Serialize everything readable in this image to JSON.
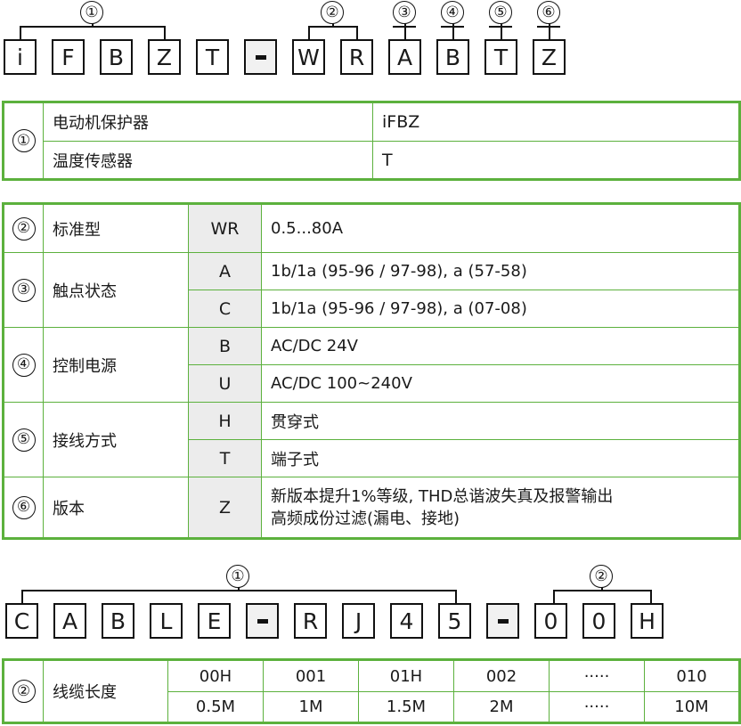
{
  "code1": {
    "chars": [
      "i",
      "F",
      "B",
      "Z",
      "T",
      "-",
      "W",
      "R",
      "A",
      "B",
      "T",
      "Z"
    ],
    "labels": [
      "①",
      "②",
      "③",
      "④",
      "⑤",
      "⑥"
    ]
  },
  "table1": {
    "group": "①",
    "rows": [
      {
        "desc": "电动机保护器",
        "value": "iFBZ"
      },
      {
        "desc": "温度传感器",
        "value": "T"
      }
    ]
  },
  "table2": {
    "groups": [
      {
        "num": "②",
        "name": "标准型",
        "rows": [
          {
            "code": "WR",
            "desc": "0.5...80A"
          }
        ]
      },
      {
        "num": "③",
        "name": "触点状态",
        "rows": [
          {
            "code": "A",
            "desc": "1b/1a (95-96 / 97-98), a (57-58)"
          },
          {
            "code": "C",
            "desc": "1b/1a (95-96 / 97-98), a (07-08)"
          }
        ]
      },
      {
        "num": "④",
        "name": "控制电源",
        "rows": [
          {
            "code": "B",
            "desc": "AC/DC 24V"
          },
          {
            "code": "U",
            "desc": "AC/DC 100~240V"
          }
        ]
      },
      {
        "num": "⑤",
        "name": "接线方式",
        "rows": [
          {
            "code": "H",
            "desc": "贯穿式"
          },
          {
            "code": "T",
            "desc": "端子式"
          }
        ]
      },
      {
        "num": "⑥",
        "name": "版本",
        "rows": [
          {
            "code": "Z",
            "desc_line1": "新版本提升1%等级, THD总谐波失真及报警输出",
            "desc_line2": "高频成份过滤(漏电、接地)"
          }
        ]
      }
    ]
  },
  "code2": {
    "chars": [
      "C",
      "A",
      "B",
      "L",
      "E",
      "-",
      "R",
      "J",
      "4",
      "5",
      "-",
      "0",
      "0",
      "H"
    ],
    "labels": [
      "①",
      "②"
    ]
  },
  "table3": {
    "num": "②",
    "name": "线缆长度",
    "codes": [
      "00H",
      "001",
      "01H",
      "002",
      "·····",
      "010"
    ],
    "lengths": [
      "0.5M",
      "1M",
      "1.5M",
      "2M",
      "·····",
      "10M"
    ]
  }
}
